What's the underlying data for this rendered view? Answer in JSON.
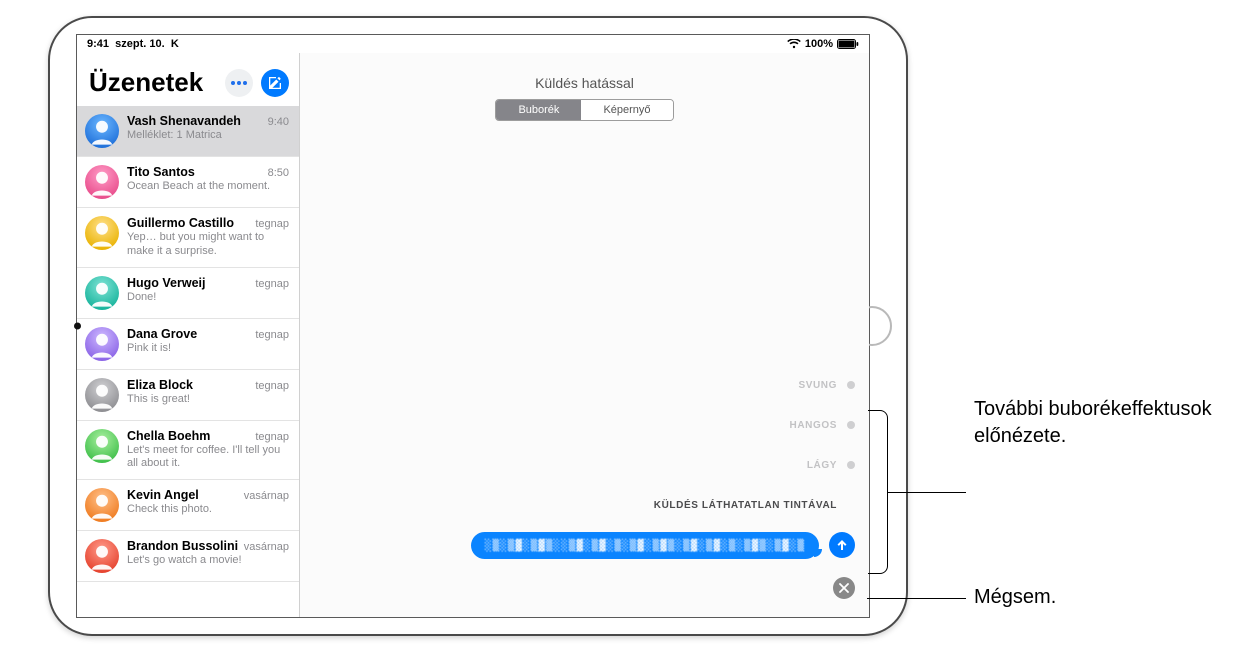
{
  "status": {
    "time": "9:41",
    "date": "szept. 10.",
    "day": "K",
    "battery": "100%"
  },
  "sidebar": {
    "title": "Üzenetek",
    "conversations": [
      {
        "name": "Vash Shenavandeh",
        "time": "9:40",
        "preview": "Melléklet: 1 Matrica",
        "avatar": "blue-profile"
      },
      {
        "name": "Tito Santos",
        "time": "8:50",
        "preview": "Ocean Beach at the moment.",
        "avatar": "pink-profile"
      },
      {
        "name": "Guillermo Castillo",
        "time": "tegnap",
        "preview": "Yep… but you might want to make it a surprise.",
        "avatar": "yellow-profile"
      },
      {
        "name": "Hugo Verweij",
        "time": "tegnap",
        "preview": "Done!",
        "avatar": "teal-profile"
      },
      {
        "name": "Dana Grove",
        "time": "tegnap",
        "preview": "Pink it is!",
        "avatar": "lavender-profile"
      },
      {
        "name": "Eliza Block",
        "time": "tegnap",
        "preview": "This is great!",
        "avatar": "grey-profile"
      },
      {
        "name": "Chella Boehm",
        "time": "tegnap",
        "preview": "Let's meet for coffee. I'll tell you all about it.",
        "avatar": "green-profile"
      },
      {
        "name": "Kevin Angel",
        "time": "vasárnap",
        "preview": "Check this photo.",
        "avatar": "orange-profile"
      },
      {
        "name": "Brandon Bussolini",
        "time": "vasárnap",
        "preview": "Let's go watch a movie!",
        "avatar": "red-profile"
      }
    ]
  },
  "detail": {
    "title": "Küldés hatással",
    "seg_bubble": "Buborék",
    "seg_screen": "Képernyő",
    "effects": {
      "slam": "SVUNG",
      "loud": "HANGOS",
      "gentle": "LÁGY",
      "ink": "KÜLDÉS LÁTHATATLAN TINTÁVAL"
    },
    "ink_bubble_text": "░▒░▒▓░▒▓▒░░▒▓░▒▓░▒░▒▓░▒▓▒░▒▓░▒▓░▒░▒▓▒░▒▓░▒"
  },
  "callouts": {
    "preview": "További buborékeffektusok előnézete.",
    "cancel": "Mégsem."
  }
}
